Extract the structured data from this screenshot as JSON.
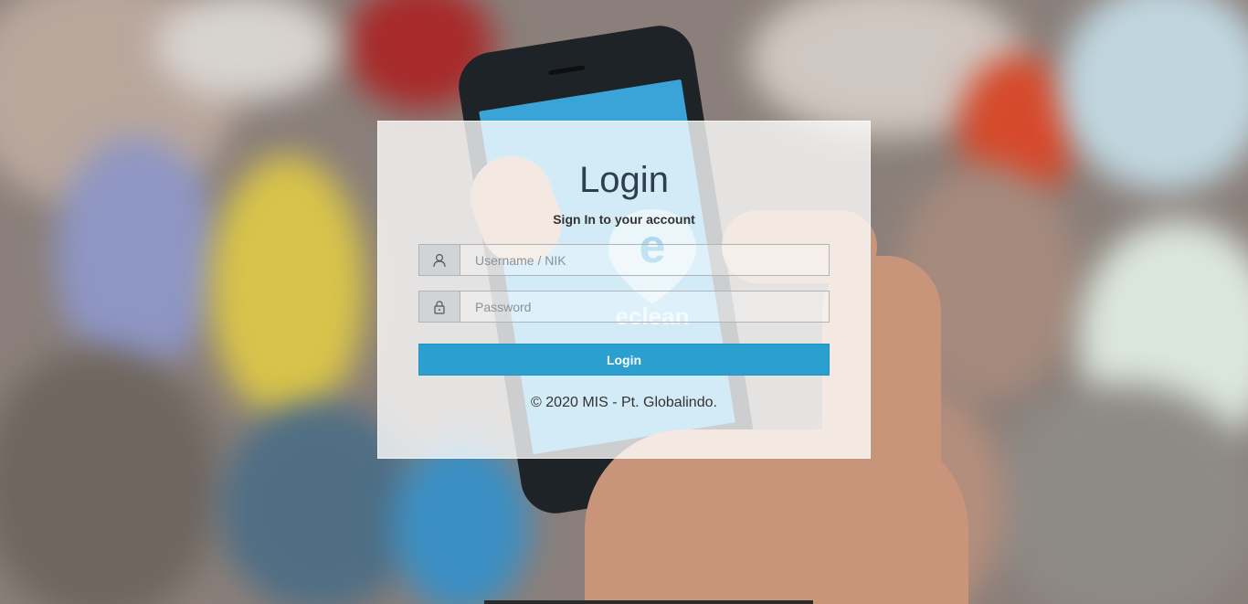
{
  "login": {
    "title": "Login",
    "subtitle": "Sign In to your account",
    "username": {
      "placeholder": "Username / NIK",
      "value": "",
      "icon": "user-icon"
    },
    "password": {
      "placeholder": "Password",
      "value": "",
      "icon": "lock-icon"
    },
    "button_label": "Login",
    "copyright": "© 2020 MIS - Pt. Globalindo."
  },
  "brand": {
    "watermark_text": "eclean"
  },
  "colors": {
    "accent": "#2a9fd0",
    "title": "#2c3e50",
    "card_bg": "rgba(255,255,255,0.78)"
  }
}
